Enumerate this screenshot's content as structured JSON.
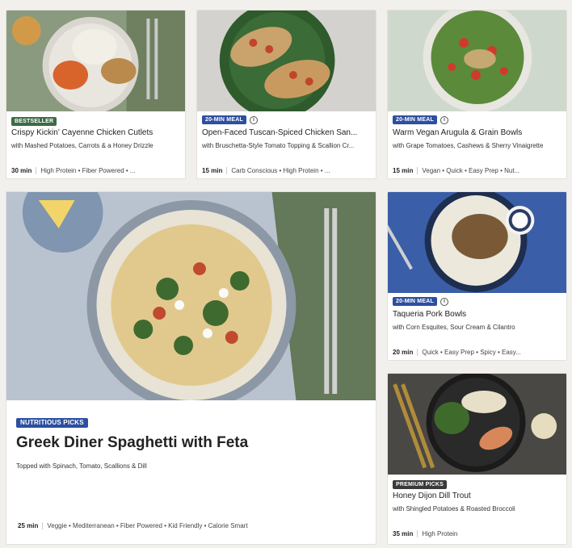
{
  "cards": [
    {
      "badge": "Bestseller",
      "title": "Crispy Kickin’ Cayenne Chicken Cutlets",
      "subtitle": "with Mashed Potatoes, Carrots & a Honey Drizzle",
      "time": "30 min",
      "tags": "High Protein • Fiber Powered • ..."
    },
    {
      "badge": "20-min meal",
      "title": "Open-Faced Tuscan-Spiced Chicken San...",
      "subtitle": "with Bruschetta-Style Tomato Topping & Scallion Cr...",
      "time": "15 min",
      "tags": "Carb Conscious • High Protein • ..."
    },
    {
      "badge": "20-min meal",
      "title": "Warm Vegan Arugula & Grain Bowls",
      "subtitle": "with Grape Tomatoes, Cashews & Sherry Vinaigrette",
      "time": "15 min",
      "tags": "Vegan • Quick • Easy Prep • Nut..."
    },
    {
      "badge": "Nutritious picks",
      "title": "Greek Diner Spaghetti with Feta",
      "subtitle": "Topped with Spinach, Tomato, Scallions & Dill",
      "time": "25 min",
      "tags": "Veggie • Mediterranean • Fiber Powered • Kid Friendly • Calorie Smart"
    },
    {
      "badge": "20-min meal",
      "title": "Taqueria Pork Bowls",
      "subtitle": "with Corn Esquites, Sour Cream & Cilantro",
      "time": "20 min",
      "tags": "Quick • Easy Prep • Spicy • Easy..."
    },
    {
      "badge": "Premium picks",
      "title": "Honey Dijon Dill Trout",
      "subtitle": "with Shingled Potatoes & Roasted Broccoli",
      "time": "35 min",
      "tags": "High Protein"
    }
  ],
  "colors": {
    "bestseller": "#3d6b47",
    "quick": "#2d4fa0",
    "premium": "#3a3a3a"
  }
}
